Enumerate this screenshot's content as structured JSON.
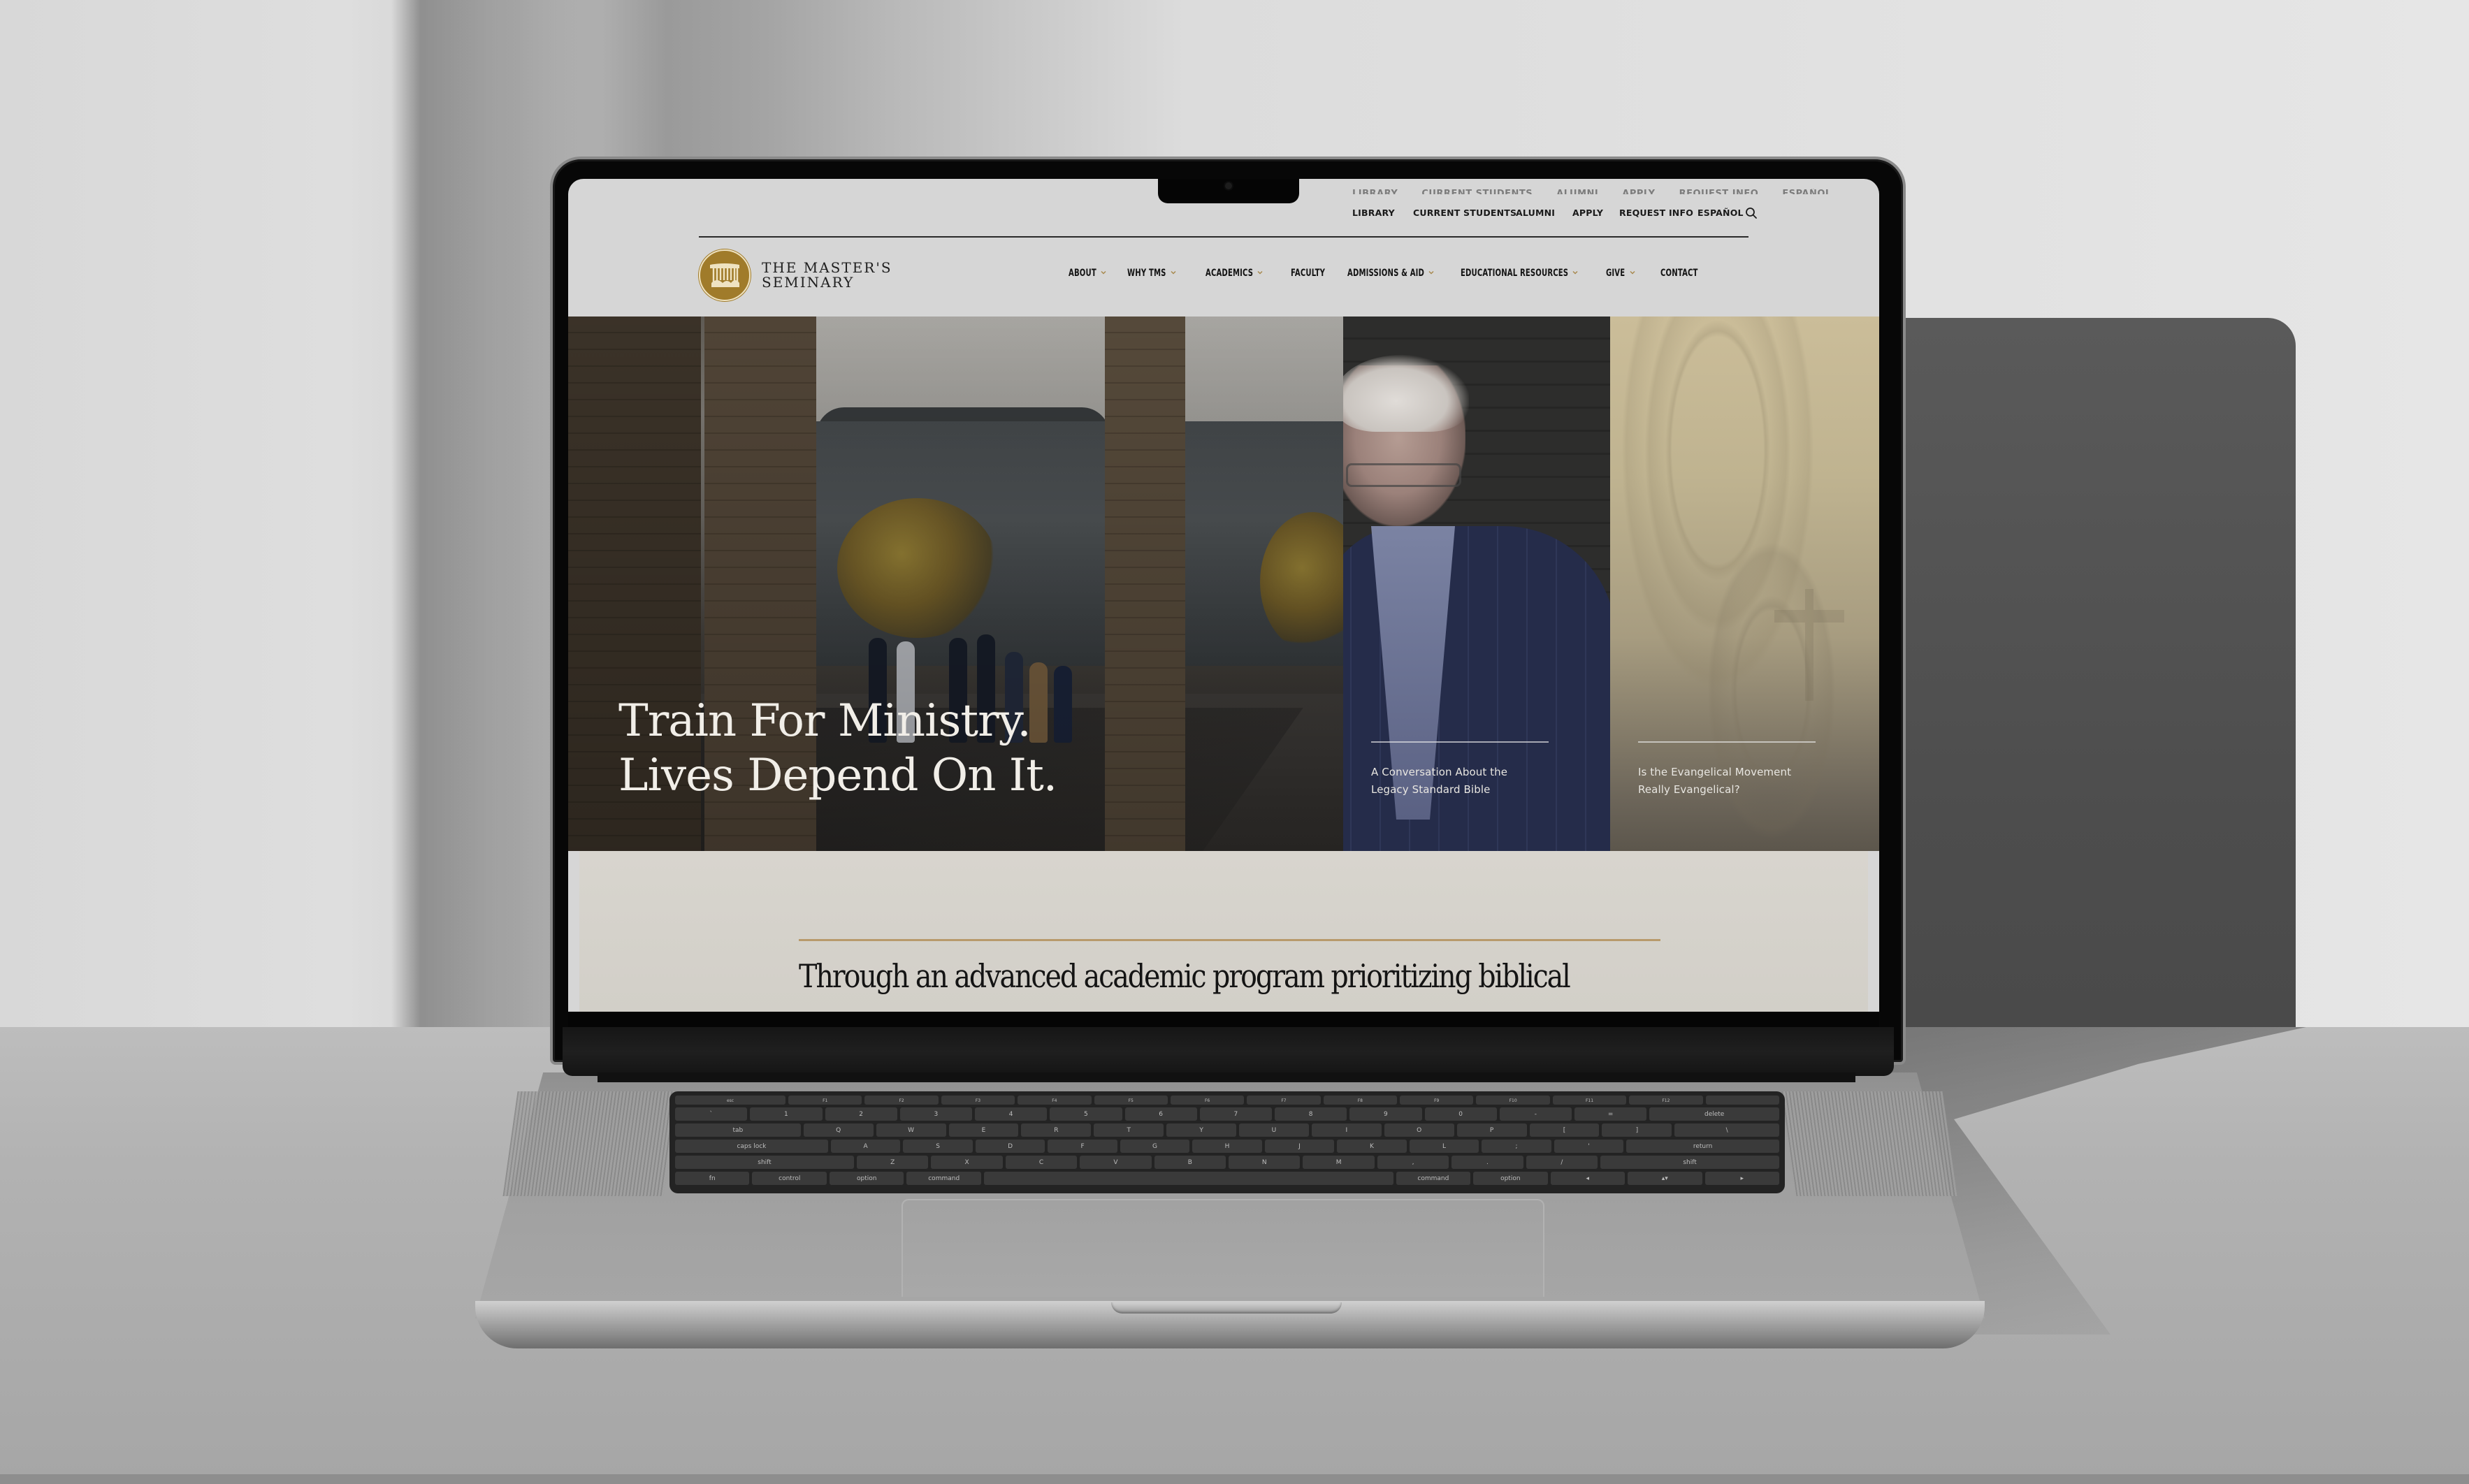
{
  "site": {
    "name_line1": "THE MASTER'S",
    "name_line2": "SEMINARY",
    "brand_color": "#a07b2a",
    "accent_rule_color": "#b89a6b"
  },
  "utility_nav": {
    "items": [
      {
        "label": "LIBRARY"
      },
      {
        "label": "CURRENT STUDENTS"
      },
      {
        "label": "ALUMNI"
      },
      {
        "label": "APPLY"
      },
      {
        "label": "REQUEST INFO"
      },
      {
        "label": "ESPAÑOL"
      }
    ],
    "search_icon": "search-icon"
  },
  "main_nav": {
    "items": [
      {
        "label": "ABOUT",
        "has_dropdown": true
      },
      {
        "label": "WHY TMS",
        "has_dropdown": true
      },
      {
        "label": "ACADEMICS",
        "has_dropdown": true
      },
      {
        "label": "FACULTY",
        "has_dropdown": false
      },
      {
        "label": "ADMISSIONS & AID",
        "has_dropdown": true
      },
      {
        "label": "EDUCATIONAL RESOURCES",
        "has_dropdown": true
      },
      {
        "label": "GIVE",
        "has_dropdown": true
      },
      {
        "label": "CONTACT",
        "has_dropdown": false
      }
    ]
  },
  "hero": {
    "headline_line1": "Train For Ministry.",
    "headline_line2": "Lives Depend On It.",
    "cards": [
      {
        "title_line1": "A Conversation About the",
        "title_line2": "Legacy Standard Bible"
      },
      {
        "title_line1": "Is the Evangelical Movement",
        "title_line2": "Really Evangelical?"
      }
    ]
  },
  "intro": {
    "text": "Through an advanced academic program prioritizing biblical"
  },
  "keyboard": {
    "rows": [
      [
        "esc",
        "F1",
        "F2",
        "F3",
        "F4",
        "F5",
        "F6",
        "F7",
        "F8",
        "F9",
        "F10",
        "F11",
        "F12",
        ""
      ],
      [
        "`",
        "1",
        "2",
        "3",
        "4",
        "5",
        "6",
        "7",
        "8",
        "9",
        "0",
        "-",
        "=",
        "delete"
      ],
      [
        "tab",
        "Q",
        "W",
        "E",
        "R",
        "T",
        "Y",
        "U",
        "I",
        "O",
        "P",
        "[",
        "]",
        "\\"
      ],
      [
        "caps lock",
        "A",
        "S",
        "D",
        "F",
        "G",
        "H",
        "J",
        "K",
        "L",
        ";",
        "'",
        "return"
      ],
      [
        "shift",
        "Z",
        "X",
        "C",
        "V",
        "B",
        "N",
        "M",
        ",",
        ".",
        "/",
        "shift"
      ],
      [
        "fn",
        "control",
        "option",
        "command",
        "",
        "command",
        "option",
        "◂",
        "▴▾",
        "▸"
      ]
    ]
  }
}
